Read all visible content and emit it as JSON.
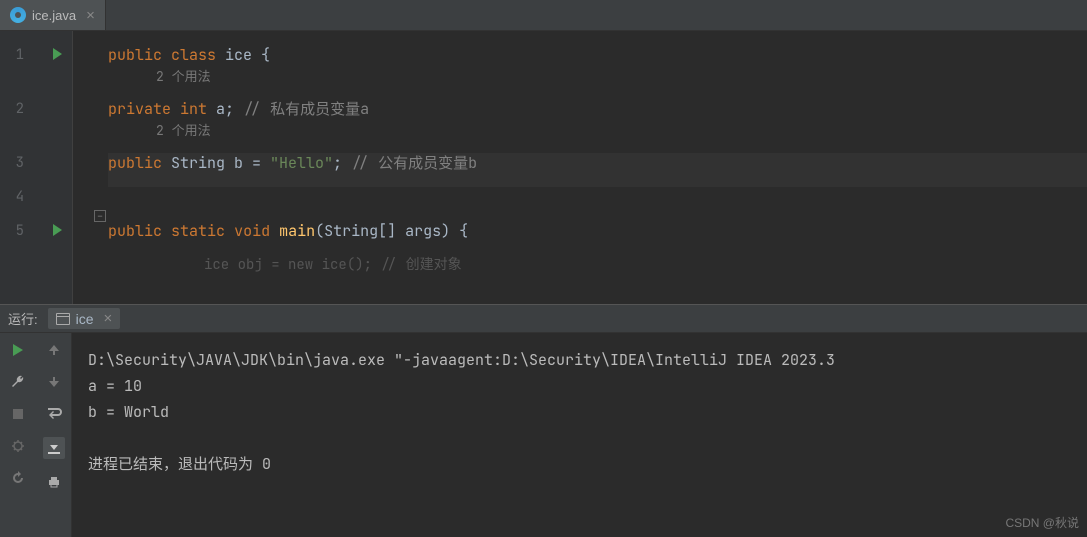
{
  "editor": {
    "tab": {
      "label": "ice.java",
      "close_glyph": "×"
    },
    "lines": [
      {
        "num": "1",
        "run": true,
        "hint": "2 个用法",
        "tokens": [
          {
            "t": "public",
            "c": "kw"
          },
          {
            "t": " "
          },
          {
            "t": "class",
            "c": "kw"
          },
          {
            "t": " ice {"
          }
        ]
      },
      {
        "num": "2",
        "hint": "2 个用法",
        "tokens": [
          {
            "t": "    "
          },
          {
            "t": "private",
            "c": "kw"
          },
          {
            "t": " "
          },
          {
            "t": "int",
            "c": "kw"
          },
          {
            "t": " a; "
          },
          {
            "t": "// 私有成员变量a",
            "c": "cmt"
          }
        ]
      },
      {
        "num": "3",
        "highlight": true,
        "tokens": [
          {
            "t": "    "
          },
          {
            "t": "public",
            "c": "kw"
          },
          {
            "t": " String b = "
          },
          {
            "t": "\"Hello\"",
            "c": "str"
          },
          {
            "t": "; "
          },
          {
            "t": "// 公有成员变量b",
            "c": "cmt"
          }
        ]
      },
      {
        "num": "4",
        "tokens": []
      },
      {
        "num": "5",
        "run": true,
        "fold": true,
        "tokens": [
          {
            "t": "    "
          },
          {
            "t": "public",
            "c": "kw"
          },
          {
            "t": " "
          },
          {
            "t": "static",
            "c": "kw"
          },
          {
            "t": " "
          },
          {
            "t": "void",
            "c": "kw"
          },
          {
            "t": " "
          },
          {
            "t": "main",
            "c": "fn"
          },
          {
            "t": "(String[] args) {"
          }
        ]
      }
    ],
    "partial": "ice obj = new ice(); // 创建对象"
  },
  "run": {
    "panel_title": "运行:",
    "tab_label": "ice",
    "tab_close": "×",
    "output": [
      "D:\\Security\\JAVA\\JDK\\bin\\java.exe \"-javaagent:D:\\Security\\IDEA\\IntelliJ IDEA 2023.3",
      "a = 10",
      "b = World",
      "",
      "进程已结束，退出代码为 0"
    ]
  },
  "watermark": "CSDN @秋说"
}
